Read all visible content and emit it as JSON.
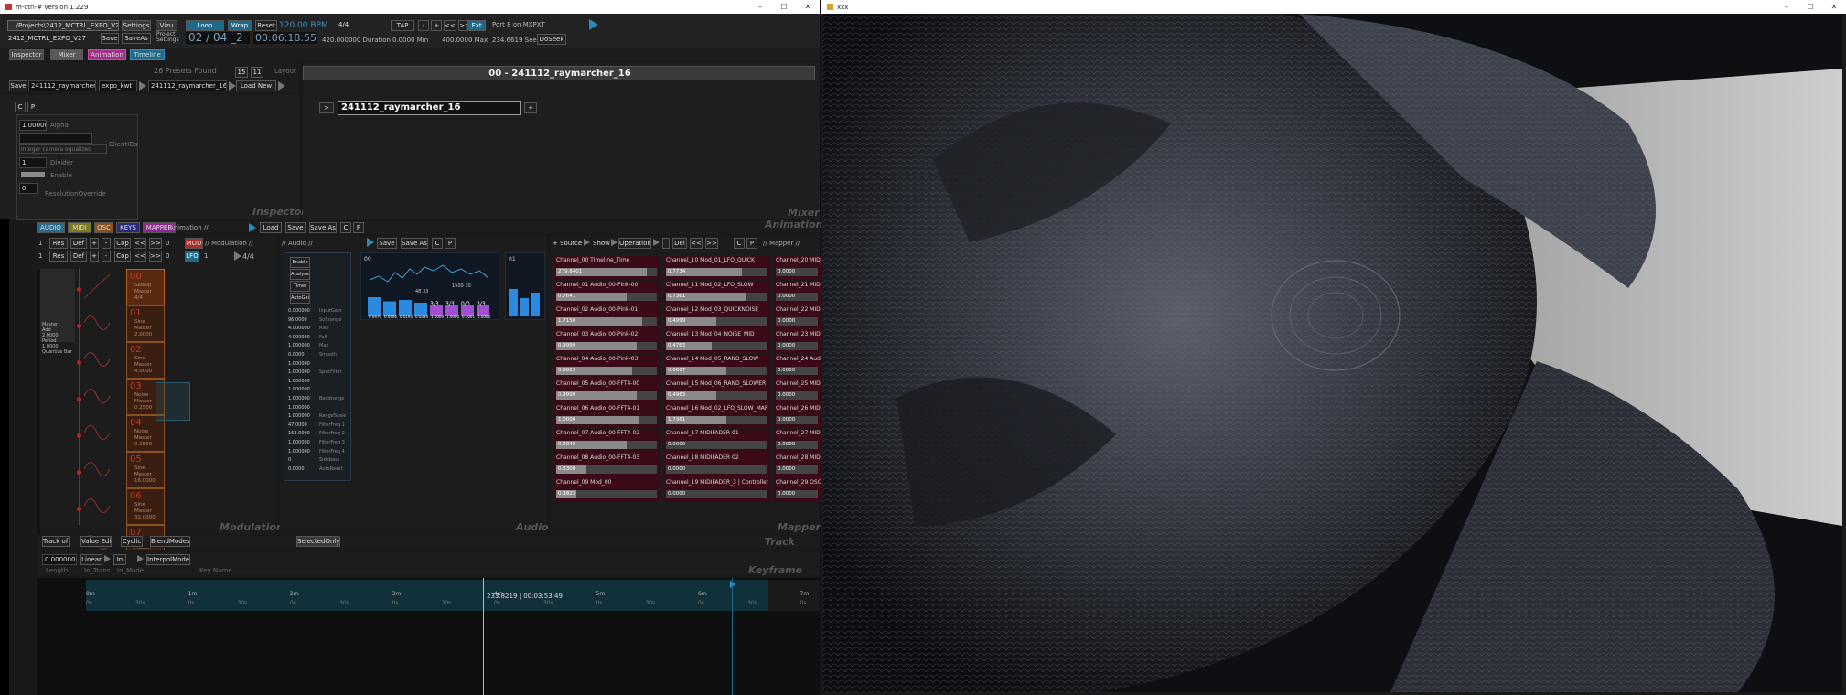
{
  "left_window": {
    "title": "m-ctrl-# version 1.229",
    "controls": [
      "–",
      "☐",
      "✕"
    ]
  },
  "right_window": {
    "title": "xxx",
    "controls": [
      "–",
      "☐",
      "✕"
    ]
  },
  "top": {
    "project_path": ".../Projects\\2412_MCTRL_EXPO_V27.xml",
    "project_name": "2412_MCTRL_EXPO_V27",
    "settings": "Settings",
    "vizu": "Vizu",
    "save": "Save",
    "saveas": "SaveAs",
    "project_settings": "Project Settings",
    "loop": "Loop",
    "wrap": "Wrap",
    "reset": "Reset",
    "bpm": "120.00 BPM",
    "sig": "4/4",
    "bar_display": "02 / 04 _2",
    "time_display": "00:06:18:55",
    "duration": "420.000000 Duration",
    "min": "0.0000 Min",
    "max": "400.0000 Max",
    "seek_val": "234.6619 Seek",
    "doseek": "DoSeek",
    "tap": "TAP",
    "clk_minus": "-",
    "clk_plus": "+",
    "clk_lt": "<<",
    "clk_gt": ">>",
    "ext": "Ext",
    "midi_port": "Port 8 on MXPXT"
  },
  "tabs": [
    "Inspector",
    "Mixer",
    "Animation",
    "Timeline"
  ],
  "presets": {
    "found": "26 Presets Found",
    "layout_lbl": "Layout",
    "save": "Save",
    "preset_name": "241112_raymarcher_16",
    "expo": "expo_kwt",
    "preset2": "241112_raymarcher_16",
    "load_new": "Load New",
    "page_a": "15",
    "page_b": "11"
  },
  "mixer": {
    "title": "00 - 241112_raymarcher_16",
    "name_field": "241112_raymarcher_16",
    "btn_left": ">",
    "btn_right": "+",
    "label": "Mixer"
  },
  "inspector": {
    "label": "Inspector",
    "c": "C",
    "p": "P",
    "alpha_val": "1.000000",
    "alpha_lbl": "Alpha",
    "integer_lbl": "Integer camera equalized",
    "clientids_lbl": "ClientIDs",
    "divider_val": "1",
    "divider_lbl": "Divider",
    "enable_lbl": "Enable",
    "resolution_val": "0",
    "resolution_lbl": "ResolutionOverride"
  },
  "animation": {
    "label": "Animation",
    "chips": [
      {
        "t": "AUDIO",
        "c": "#2a6a8a"
      },
      {
        "t": "MIDI",
        "c": "#7a7a20"
      },
      {
        "t": "OSC",
        "c": "#8a5020"
      },
      {
        "t": "KEYS",
        "c": "#2a2a7a"
      },
      {
        "t": "MAPPER",
        "c": "#8a2a8a"
      }
    ],
    "path": "// Animation //",
    "load": "Load",
    "save": "Save",
    "saveas": "Save As",
    "c": "C",
    "p": "P"
  },
  "modulation": {
    "label": "Modulation",
    "row1": {
      "num": "1",
      "res": "Res",
      "def": "Def",
      "plus": "+",
      "minus": "-",
      "cop": "Cop",
      "lt": "<<",
      "gt": ">>",
      "zero": "0",
      "mod": "MOD",
      "path": "// Modulation //"
    },
    "row2": {
      "num": "1",
      "res": "Res",
      "def": "Def",
      "plus": "+",
      "minus": "-",
      "cop": "Cop",
      "lt": "<<",
      "gt": ">>",
      "zero": "0",
      "lfo": "LFO",
      "lfo_num": "1",
      "sig": "4/4"
    },
    "left_items": [
      "Master",
      "Add",
      "2.0000",
      "Period",
      "1.0000",
      "Quantize Bar"
    ],
    "nodes": [
      {
        "t": "00",
        "lines": [
          "Sawup",
          "Master",
          "4/4"
        ]
      },
      {
        "t": "01",
        "lines": [
          "Sine",
          "Master",
          "2.0000"
        ]
      },
      {
        "t": "02",
        "lines": [
          "Sine",
          "Master",
          "4.0000"
        ]
      },
      {
        "t": "03",
        "lines": [
          "Noise",
          "Master",
          "0.2500"
        ]
      },
      {
        "t": "04",
        "lines": [
          "Noise",
          "Master",
          "0.2500"
        ]
      },
      {
        "t": "05",
        "lines": [
          "Sine",
          "Master",
          "16.0000"
        ]
      },
      {
        "t": "06",
        "lines": [
          "Sine",
          "Master",
          "32.0000"
        ]
      },
      {
        "t": "07",
        "lines": [
          "Sine",
          "Master",
          "16.0000"
        ]
      }
    ]
  },
  "audio": {
    "label": "Audio",
    "path": "// Audio //",
    "save": "Save",
    "saveas": "Save As",
    "c": "C",
    "p": "P",
    "buttons": [
      "Enable",
      "Analyse",
      "Timer",
      "AutoGain"
    ],
    "params": [
      [
        "0.000000",
        "InputGain"
      ],
      [
        "96.0000",
        "Softrange"
      ],
      [
        "4.000000",
        "Rise"
      ],
      [
        "4.000000",
        "Fall"
      ],
      [
        "1.000000",
        "Max"
      ],
      [
        "0.0000",
        "Smooth"
      ],
      [
        "1.000000",
        ""
      ],
      [
        "1.000000",
        "SpecFilter"
      ],
      [
        "1.000000",
        ""
      ],
      [
        "1.000000",
        ""
      ],
      [
        "1.000000",
        "Bandrange"
      ],
      [
        "1.000000",
        ""
      ],
      [
        "1.000000",
        "RangeScale"
      ],
      [
        "47.0000",
        "FilterFreq 1"
      ],
      [
        "163.0000",
        "FilterFreq 2"
      ],
      [
        "1.000000",
        "FilterFreq 3"
      ],
      [
        "1.000000",
        "FilterFreq 4"
      ],
      [
        "0",
        "Sidebass"
      ],
      [
        "0.0000",
        "AutoReset"
      ]
    ],
    "fft_title": "00",
    "fft2_title": "01",
    "bars": [
      {
        "v": 0.7,
        "l": "0.0470"
      },
      {
        "v": 0.55,
        "l": "0.0406"
      },
      {
        "v": 0.6,
        "l": "0.0193"
      },
      {
        "v": 0.5,
        "l": "0.0334"
      },
      {
        "v": 0.4,
        "l": "1.0000"
      },
      {
        "v": 0.4,
        "l": "1.0000"
      },
      {
        "v": 0.4,
        "l": "0.3001"
      },
      {
        "v": 0.4,
        "l": "1.0000"
      }
    ],
    "bar_labels": [
      "3/3",
      "3/3",
      "0/0",
      "3/3"
    ],
    "peak_labels": [
      "48 33",
      "48 33",
      "1500 30"
    ]
  },
  "mapper": {
    "label": "Mapper",
    "source": "+ Source",
    "show": "Show",
    "operations": "Operations",
    "del": "Del",
    "lt": "<<",
    "gt": ">>",
    "c": "C",
    "p": "P",
    "path": "// Mapper //",
    "channels": [
      {
        "n": "Channel_00 Timeline_Time",
        "v": "279.6401",
        "f": 0.9
      },
      {
        "n": "Channel_01 Audio_00-Pink-00",
        "v": "0.7641",
        "f": 0.7
      },
      {
        "n": "Channel_02 Audio_00-Pink-01",
        "v": "1.7150",
        "f": 0.85
      },
      {
        "n": "Channel_03 Audio_00-Pink-02",
        "v": "0.9999",
        "f": 0.8
      },
      {
        "n": "Channel_04 Audio_00-Pink-03",
        "v": "0.8823",
        "f": 0.75
      },
      {
        "n": "Channel_05 Audio_00-FFT4-00",
        "v": "0.9999",
        "f": 0.8
      },
      {
        "n": "Channel_06 Audio_00-FFT4-01",
        "v": "1.0000",
        "f": 0.82
      },
      {
        "n": "Channel_07 Audio_00-FFT4-02",
        "v": "0.0040",
        "f": 0.7
      },
      {
        "n": "Channel_08 Audio_00-FFT4-03",
        "v": "0.3300",
        "f": 0.3
      },
      {
        "n": "Channel_09 Mod_00",
        "v": "0.3823",
        "f": 0.2
      },
      {
        "n": "Channel_10 Mod_01_LFO_QUICK",
        "v": "0.7734",
        "f": 0.75
      },
      {
        "n": "Channel_11 Mod_02_LFO_SLOW",
        "v": "0.7361",
        "f": 0.8
      },
      {
        "n": "Channel_12 Mod_03_QUICKNOISE",
        "v": "0.4999",
        "f": 0.5
      },
      {
        "n": "Channel_13 Mod_04_NOISE_MID",
        "v": "0.4763",
        "f": 0.45
      },
      {
        "n": "Channel_14 Mod_05_RAND_SLOW",
        "v": "0.6667",
        "f": 0.6
      },
      {
        "n": "Channel_15 Mod_06_RAND_SLOWER",
        "v": "0.4963",
        "f": 0.5
      },
      {
        "n": "Channel_16 Mod_02_LFO_SLOW_MAPPED",
        "v": "1.7361",
        "f": 0.6
      },
      {
        "n": "Channel_17 MIDIFADER 01",
        "v": "0.0000",
        "f": 0
      },
      {
        "n": "Channel_18 MIDIFADER 02",
        "v": "0.0000",
        "f": 0
      },
      {
        "n": "Channel_19 MIDIFADER_3 | Controller Ch",
        "v": "0.0000",
        "f": 0
      },
      {
        "n": "Channel_20 MIDI",
        "v": "0.0000",
        "f": 0
      },
      {
        "n": "Channel_21 MIDI",
        "v": "0.0000",
        "f": 0
      },
      {
        "n": "Channel_22 MIDI",
        "v": "0.0000",
        "f": 0
      },
      {
        "n": "Channel_23 MIDI",
        "v": "0.0000",
        "f": 0
      },
      {
        "n": "Channel_24 Audio",
        "v": "0.0000",
        "f": 0
      },
      {
        "n": "Channel_25 MIDI",
        "v": "0.0000",
        "f": 0
      },
      {
        "n": "Channel_26 MIDI",
        "v": "0.0000",
        "f": 0
      },
      {
        "n": "Channel_27 MIDI",
        "v": "0.0000",
        "f": 0
      },
      {
        "n": "Channel_28 MIDI",
        "v": "0.0000",
        "f": 0
      },
      {
        "n": "Channel_29 OSC",
        "v": "0.0000",
        "f": 0
      }
    ]
  },
  "trackedit": {
    "label": "Track Edit",
    "track_off": "Track off",
    "value_edit": "Value Edit",
    "cyclic": "Cyclic",
    "blend": "BlendModes",
    "selected_only": "SelectedOnly"
  },
  "keyframe": {
    "label": "Keyframe Edit",
    "value": "0.000000",
    "linear": "Linear",
    "in": "In",
    "interpol": "InterpolModes",
    "col1": "Length",
    "col2": "In_Trans",
    "col3": "In_Mode",
    "col4": "Key Name"
  },
  "timeline": {
    "playhead": "233.8219 | 00:03:53:49",
    "marks": [
      "0m",
      "1m",
      "2m",
      "3m",
      "4m",
      "5m",
      "6m",
      "7m"
    ],
    "sub": "30s",
    "zero": "0s"
  }
}
